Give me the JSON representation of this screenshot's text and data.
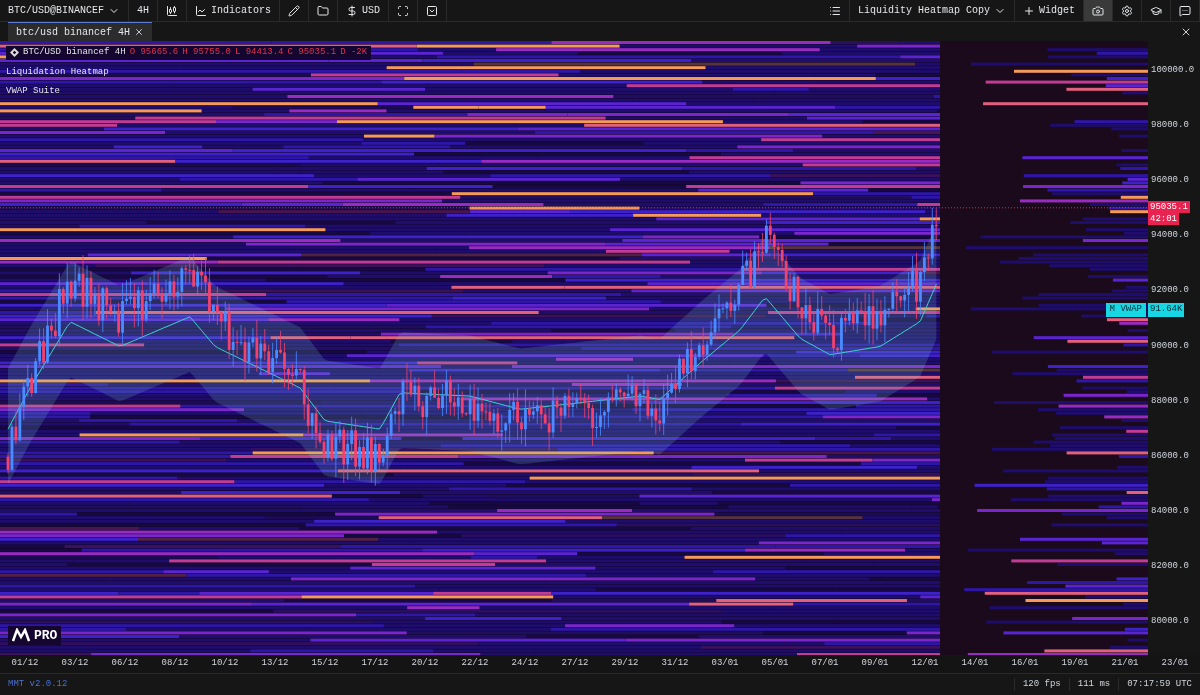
{
  "toolbar": {
    "symbol": "BTC/USD@BINANCEF",
    "interval": "4H",
    "indicators": "Indicators",
    "currency": "USD",
    "layout": "Liquidity Heatmap Copy",
    "widget": "Widget",
    "camera_selected": true
  },
  "tabs": [
    {
      "label": "btc/usd binancef 4H",
      "selected": true
    }
  ],
  "legend": {
    "title": "BTC/USD binancef 4H",
    "ohlc": [
      {
        "label": "O",
        "value": "95665.6"
      },
      {
        "label": "H",
        "value": "95755.0"
      },
      {
        "label": "L",
        "value": "94413.4"
      },
      {
        "label": "C",
        "value": "95035.1"
      },
      {
        "label": "D",
        "value": "-2K"
      }
    ],
    "indicators": [
      "Liquidation Heatmap",
      "VWAP Suite"
    ]
  },
  "price_axis": [
    "100000.0",
    "98000.0",
    "96000.0",
    "94000.0",
    "92000.0",
    "90000.0",
    "88000.0",
    "86000.0",
    "84000.0",
    "82000.0",
    "80000.0"
  ],
  "price_tag": {
    "price": "95035.1",
    "countdown": "42:01"
  },
  "vwap_tag": {
    "label": "M VWAP",
    "value": "91.64K"
  },
  "logo": {
    "text": "PRO"
  },
  "time_axis": [
    "01/12",
    "03/12",
    "06/12",
    "08/12",
    "10/12",
    "13/12",
    "15/12",
    "17/12",
    "20/12",
    "22/12",
    "24/12",
    "27/12",
    "29/12",
    "31/12",
    "03/01",
    "05/01",
    "07/01",
    "09/01",
    "12/01",
    "14/01",
    "16/01",
    "19/01",
    "21/01",
    "23/01"
  ],
  "status_bar": {
    "version": "MMT v2.0.12",
    "fps": "120 fps",
    "latency": "111 ms",
    "clock": "07:17:59 UTC"
  }
}
